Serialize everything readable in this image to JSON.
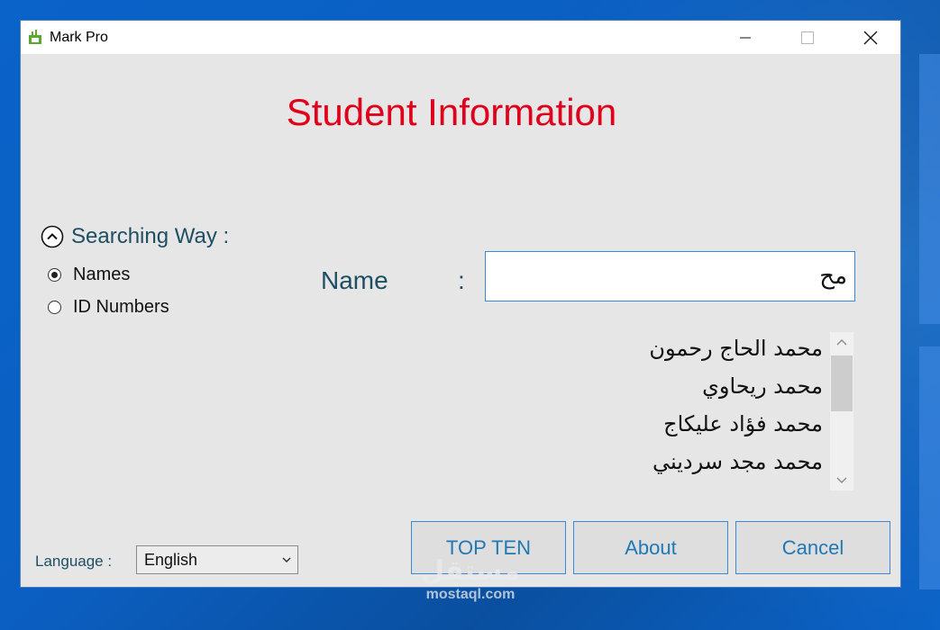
{
  "window": {
    "title": "Mark Pro"
  },
  "header": {
    "title": "Student Information"
  },
  "search_way": {
    "label": "Searching Way :",
    "options": [
      {
        "label": "Names",
        "selected": true
      },
      {
        "label": "ID Numbers",
        "selected": false
      }
    ]
  },
  "name_field": {
    "label": "Name",
    "colon": ":",
    "value": "مح"
  },
  "results": [
    "محمد الحاج رحمون",
    "محمد ريحاوي",
    "محمد فؤاد عليكاج",
    "محمد مجد سرديني"
  ],
  "buttons": {
    "top_ten": "TOP TEN",
    "about": "About",
    "cancel": "Cancel"
  },
  "language": {
    "label": "Language :",
    "selected": "English"
  },
  "watermark": {
    "arabic": "مستقل",
    "latin": "mostaql.com"
  },
  "colors": {
    "title": "#e0001b",
    "label": "#1f4e63",
    "button_text": "#2079b6",
    "accent_border": "#3a88d8"
  },
  "icons": {
    "app": "app-bar-icon",
    "collapse": "chevron-up-circle-icon",
    "minimize": "minimize-icon",
    "maximize": "maximize-icon",
    "close": "close-icon"
  }
}
